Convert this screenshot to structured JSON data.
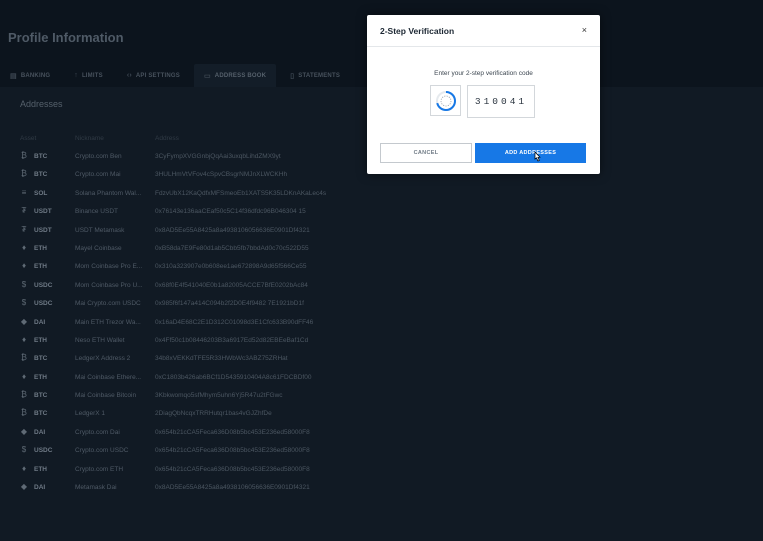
{
  "page_title": "Profile Information",
  "tabs": [
    {
      "label": "BANKING",
      "icon": "bank-icon",
      "active": false
    },
    {
      "label": "LIMITS",
      "icon": "arrow-up-icon",
      "active": false
    },
    {
      "label": "API SETTINGS",
      "icon": "code-icon",
      "active": false
    },
    {
      "label": "ADDRESS BOOK",
      "icon": "book-icon",
      "active": true
    },
    {
      "label": "STATEMENTS",
      "icon": "document-icon",
      "active": false
    }
  ],
  "addresses": {
    "title": "Addresses",
    "columns": {
      "asset": "Asset",
      "nickname": "Nickname",
      "address": "Address"
    },
    "rows": [
      {
        "icon": "₿",
        "asset": "BTC",
        "nickname": "Crypto.com Ben",
        "address": "3CyFympXVGGnbjQqAai3uxqbLihdZMX9yt"
      },
      {
        "icon": "₿",
        "asset": "BTC",
        "nickname": "Crypto.com Mai",
        "address": "3HULHmVtVFov4cSpvCBsgrNMJnXLWCKHh"
      },
      {
        "icon": "≡",
        "asset": "SOL",
        "nickname": "Solana Phantom Wal...",
        "address": "FdzvUbX12KaQdfxMFSmeoEb1XATS5K35LDKnAKaLec4s"
      },
      {
        "icon": "₮",
        "asset": "USDT",
        "nickname": "Binance USDT",
        "address": "0x76143e136aaCEaf50c5C14f36dfdc96B046304 15"
      },
      {
        "icon": "₮",
        "asset": "USDT",
        "nickname": "USDT Metamask",
        "address": "0x8AD5Ee55A8425a8a4938106056636E0901Df4321"
      },
      {
        "icon": "♦",
        "asset": "ETH",
        "nickname": "Mayel Coinbase",
        "address": "0xB58da7E9Fe80d1ab5Cbb5fb7bbdAd0c70c522D55"
      },
      {
        "icon": "♦",
        "asset": "ETH",
        "nickname": "Mom Coinbase Pro E...",
        "address": "0x310a323907e0b608ee1ae672898A9d65f566Ce55"
      },
      {
        "icon": "$",
        "asset": "USDC",
        "nickname": "Mom Coinbase Pro U...",
        "address": "0x68f0E4f541040E0b1a82005ACCE7BfE0202bAc84"
      },
      {
        "icon": "$",
        "asset": "USDC",
        "nickname": "Mai Crypto.com USDC",
        "address": "0x985f6f147a414C094b2f2D0E4f9482 7E1921bD1f"
      },
      {
        "icon": "◆",
        "asset": "DAI",
        "nickname": "Main ETH Trezor Wa...",
        "address": "0x16aD4E68C2E1D312C01098d3E1Cfc633B90dFF46"
      },
      {
        "icon": "♦",
        "asset": "ETH",
        "nickname": "Neso ETH Wallet",
        "address": "0x4Ff50c1b08446203B3a6917Ed52d82EBEeBaf1Cd"
      },
      {
        "icon": "₿",
        "asset": "BTC",
        "nickname": "LedgerX Address 2",
        "address": "34b8xVEKKdTFE5R33HWbWc3ABZ75ZRHat"
      },
      {
        "icon": "♦",
        "asset": "ETH",
        "nickname": "Mai Coinbase Ethere...",
        "address": "0xC1803b426ab6BCf1D5435910404A8c61FDCBDf00"
      },
      {
        "icon": "₿",
        "asset": "BTC",
        "nickname": "Mai Coinbase Bitcoin",
        "address": "3Kbkwomqo5sfMhym5uhn6Yj5R47u2tFGwc"
      },
      {
        "icon": "₿",
        "asset": "BTC",
        "nickname": "LedgerX 1",
        "address": "2DiagQbNcqxTRRHutqr1bas4vGJZhfDe"
      },
      {
        "icon": "◆",
        "asset": "DAI",
        "nickname": "Crypto.com Dai",
        "address": "0x654b21cCA5Feca636D08b5bc453E236ed58000F8"
      },
      {
        "icon": "$",
        "asset": "USDC",
        "nickname": "Crypto.com USDC",
        "address": "0x654b21cCA5Feca636D08b5bc453E236ed58000F8"
      },
      {
        "icon": "♦",
        "asset": "ETH",
        "nickname": "Crypto.com ETH",
        "address": "0x654b21cCA5Feca636D08b5bc453E236ed58000F8"
      },
      {
        "icon": "◆",
        "asset": "DAI",
        "nickname": "Metamask Dai",
        "address": "0x8AD5Ee55A8425a8a4938106056636E0901Df4321"
      }
    ]
  },
  "modal": {
    "title": "2-Step Verification",
    "close_label": "×",
    "prompt": "Enter your 2-step verification code",
    "code_value": "310041",
    "cancel_label": "CANCEL",
    "add_label": "ADD ADDRESSES"
  },
  "colors": {
    "accent": "#1778e6",
    "background": "#0c141d",
    "panel": "#111a24"
  }
}
